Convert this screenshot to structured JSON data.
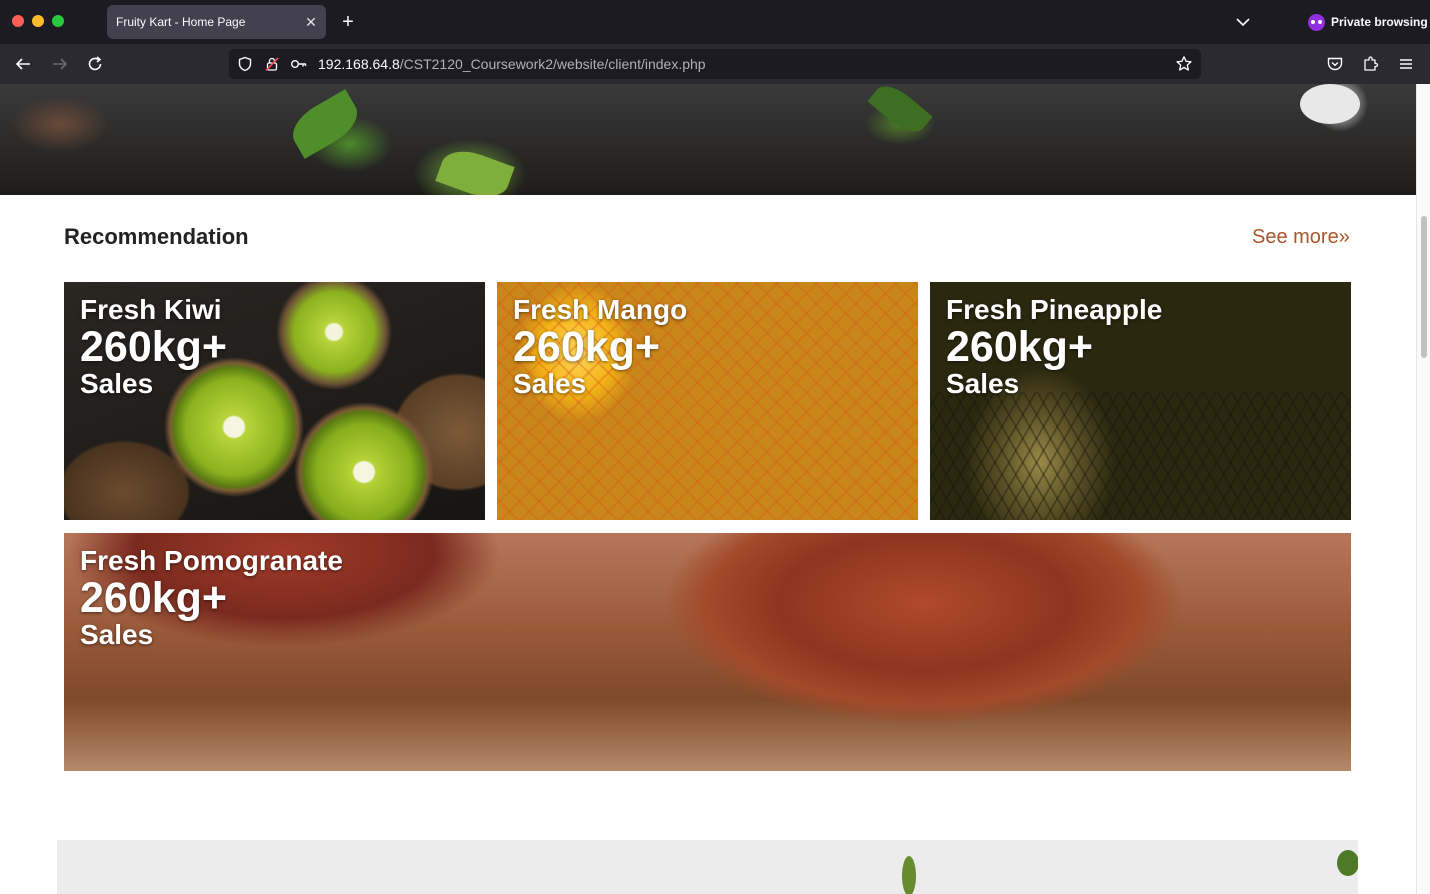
{
  "browser": {
    "tab_title": "Fruity Kart - Home Page",
    "private_label": "Private browsing",
    "url_host": "192.168.64.8",
    "url_path": "/CST2120_Coursework2/website/client/index.php"
  },
  "recommendation": {
    "title": "Recommendation",
    "see_more": "See more»",
    "cards": [
      {
        "name": "Fresh Kiwi",
        "amount": "260kg+",
        "label": "Sales"
      },
      {
        "name": "Fresh Mango",
        "amount": "260kg+",
        "label": "Sales"
      },
      {
        "name": "Fresh Pineapple",
        "amount": "260kg+",
        "label": "Sales"
      },
      {
        "name": "Fresh Pomogranate",
        "amount": "260kg+",
        "label": "Sales"
      }
    ]
  }
}
